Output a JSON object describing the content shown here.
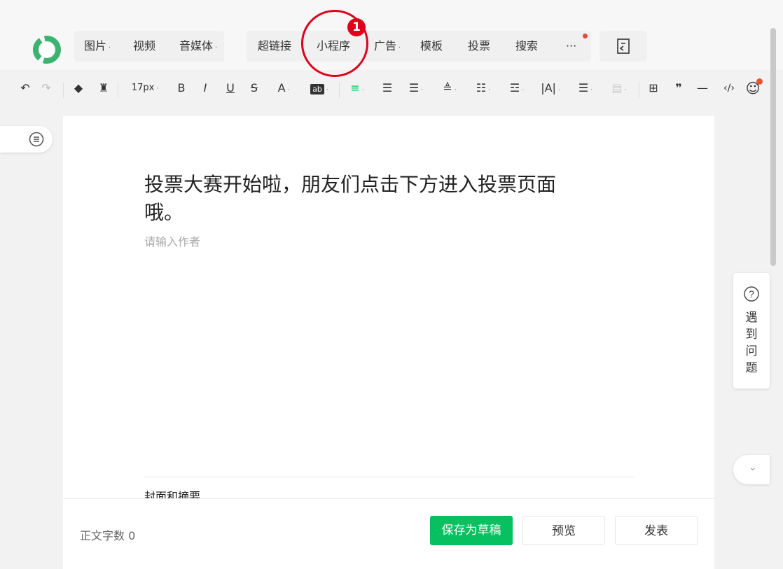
{
  "menu": {
    "items": [
      {
        "label": "图片",
        "caret": "·"
      },
      {
        "label": "视频",
        "caret": ""
      },
      {
        "label": "音媒体",
        "caret": "·"
      },
      {
        "label": "超链接",
        "caret": ""
      },
      {
        "label": "小程序",
        "caret": ""
      },
      {
        "label": "广告",
        "caret": "·"
      },
      {
        "label": "模板",
        "caret": ""
      },
      {
        "label": "投票",
        "caret": ""
      },
      {
        "label": "搜索",
        "caret": ""
      },
      {
        "label": "···",
        "caret": ""
      }
    ]
  },
  "toolbar": {
    "font_size": "17px",
    "bold": "B",
    "italic": "I",
    "underline": "U",
    "strike": "S",
    "font_color": "A",
    "highlight": "ab",
    "quote": "❞",
    "hr": "—",
    "code": "‹/›"
  },
  "article": {
    "title": "投票大赛开始啦，朋友们点击下方进入投票页面哦。",
    "author_placeholder": "请输入作者",
    "cover_label": "封面和摘要"
  },
  "footer": {
    "wordcount_label": "正文字数",
    "wordcount_value": "0",
    "save_draft": "保存为草稿",
    "preview": "预览",
    "publish": "发表"
  },
  "help": {
    "text": "遇到问题"
  },
  "annotation": {
    "badge": "1"
  },
  "colors": {
    "primary": "#07c160",
    "annotation": "#e0001b"
  }
}
